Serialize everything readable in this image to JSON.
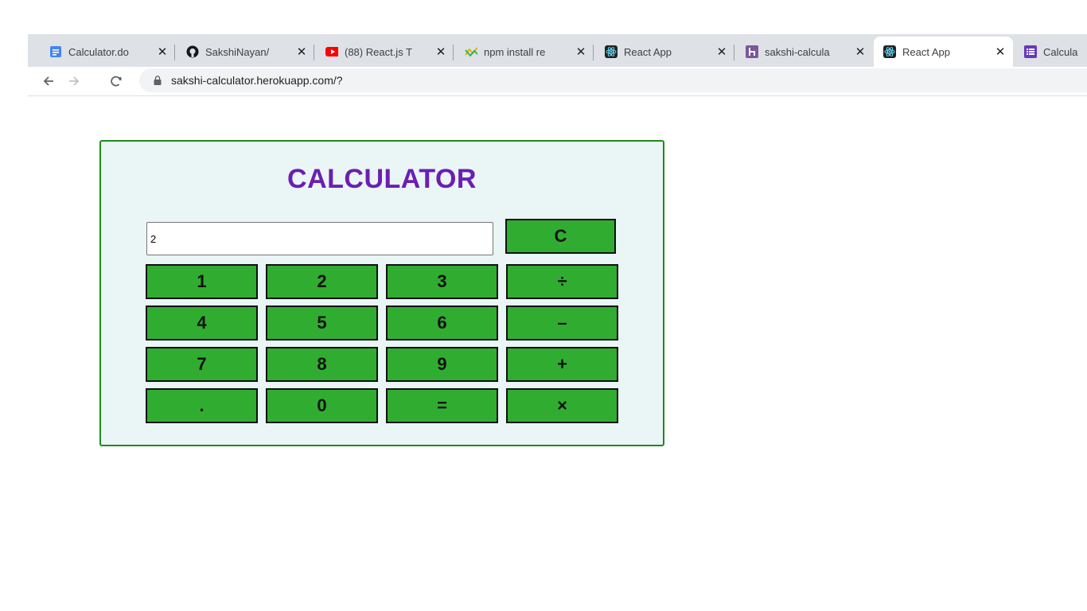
{
  "browser": {
    "tabs": [
      {
        "title": "Calculator.do",
        "icon": "google-docs-icon"
      },
      {
        "title": "SakshiNayan/",
        "icon": "github-icon"
      },
      {
        "title": "(88) React.js T",
        "icon": "youtube-icon"
      },
      {
        "title": "npm install re",
        "icon": "npm-search-icon"
      },
      {
        "title": "React App",
        "icon": "react-icon"
      },
      {
        "title": "sakshi-calcula",
        "icon": "heroku-icon"
      },
      {
        "title": "React App",
        "icon": "react-icon"
      },
      {
        "title": "Calcula",
        "icon": "form-icon"
      }
    ],
    "close_glyph": "✕",
    "url": "sakshi-calculator.herokuapp.com/?"
  },
  "calculator": {
    "title": "CALCULATOR",
    "display_value": "2",
    "keys": {
      "clear": "C",
      "k1": "1",
      "k2": "2",
      "k3": "3",
      "divide": "÷",
      "k4": "4",
      "k5": "5",
      "k6": "6",
      "minus": "–",
      "k7": "7",
      "k8": "8",
      "k9": "9",
      "plus": "+",
      "dot": ".",
      "k0": "0",
      "equals": "=",
      "multiply": "×"
    }
  },
  "colors": {
    "title": "#6a1fb3",
    "key_bg": "#30ad30",
    "panel_bg": "#eaf5f5",
    "panel_border": "#1e8a1e"
  }
}
